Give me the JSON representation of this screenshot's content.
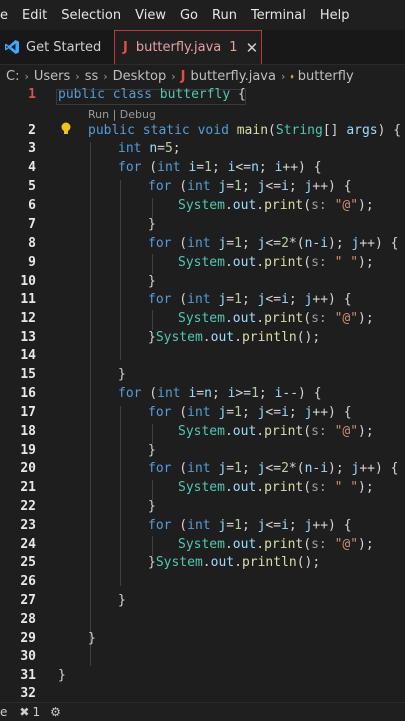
{
  "menu": [
    "e",
    "Edit",
    "Selection",
    "View",
    "Go",
    "Run",
    "Terminal",
    "Help"
  ],
  "tabs": [
    {
      "label": "Get Started",
      "active": false
    },
    {
      "label": "butterfly.java",
      "count": "1",
      "active": true
    }
  ],
  "icons": {
    "java": "J",
    "close": "✕"
  },
  "breadcrumb": [
    "C:",
    "Users",
    "ss",
    "Desktop",
    "butterfly.java",
    "butterfly"
  ],
  "codelens": "Run | Debug",
  "line_numbers": [
    "1",
    "2",
    "3",
    "4",
    "5",
    "6",
    "7",
    "8",
    "9",
    "10",
    "11",
    "12",
    "13",
    "14",
    "15",
    "16",
    "17",
    "18",
    "19",
    "20",
    "21",
    "22",
    "23",
    "24",
    "25",
    "26",
    "27",
    "28",
    "29",
    "30",
    "31",
    "32"
  ],
  "code": {
    "l1": [
      "public",
      "class",
      "butterfly",
      "{"
    ],
    "l2": [
      "public",
      "static",
      "void",
      "main",
      "(",
      "String",
      "[] ",
      "args",
      ") {"
    ],
    "l3": [
      "int",
      "n",
      "=",
      "5",
      ";"
    ],
    "for_int": "for",
    "int": "int",
    "system": "System",
    "out": "out",
    "print": "print",
    "println": "println",
    "s_hint": "s:",
    "at_str": "\"@\"",
    "space_str": "\" \""
  },
  "status": {
    "left": "e",
    "errors": "1",
    "debug": "⚙"
  }
}
